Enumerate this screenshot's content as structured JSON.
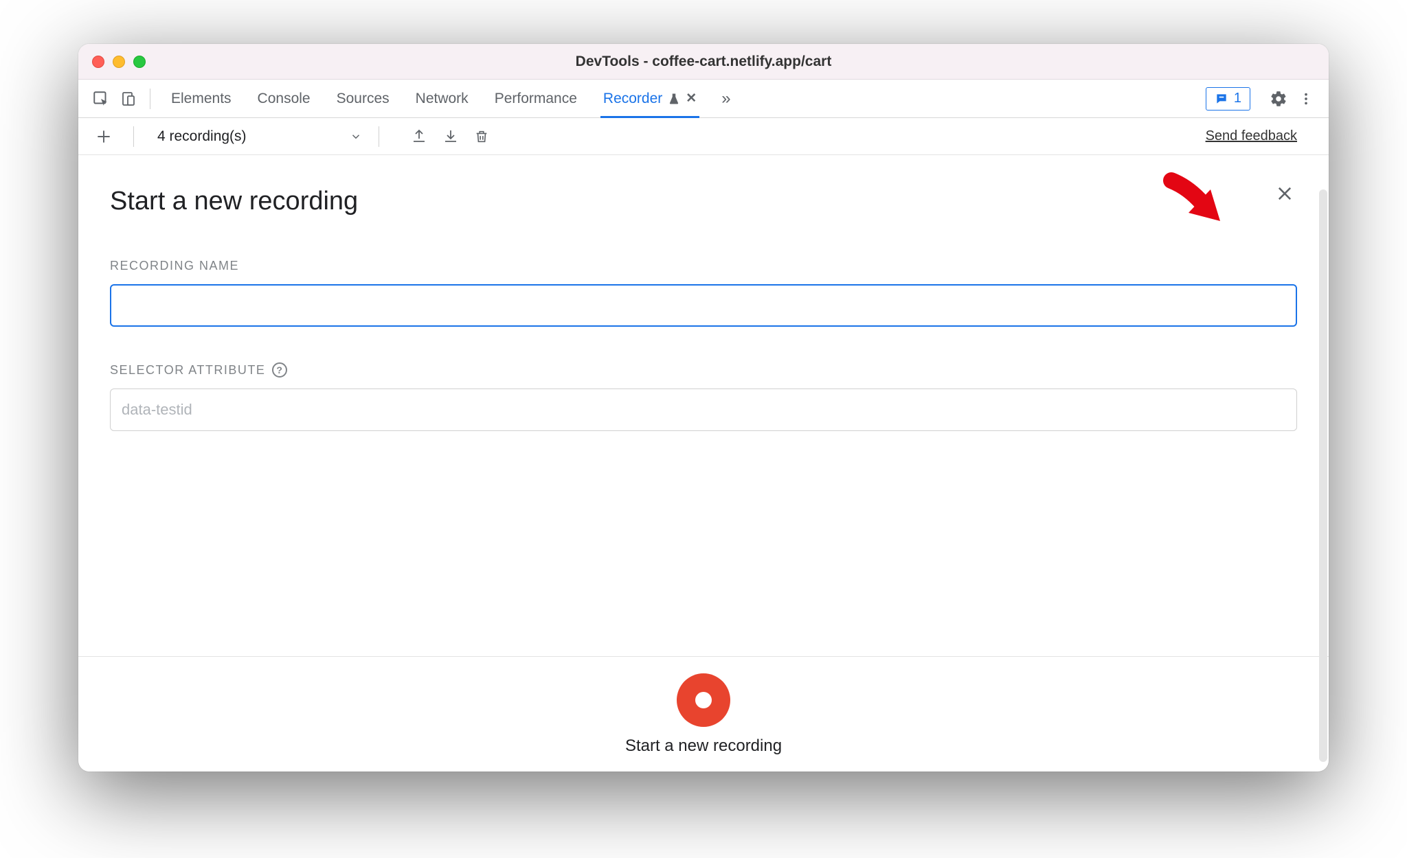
{
  "window": {
    "title": "DevTools - coffee-cart.netlify.app/cart"
  },
  "tabs": {
    "items": [
      "Elements",
      "Console",
      "Sources",
      "Network",
      "Performance"
    ],
    "active": {
      "label": "Recorder"
    }
  },
  "issues": {
    "count": "1"
  },
  "toolbar": {
    "recordings_label": "4 recording(s)",
    "feedback": "Send feedback"
  },
  "panel": {
    "title": "Start a new recording",
    "recording_name_label": "RECORDING NAME",
    "recording_name_value": "",
    "selector_label": "SELECTOR ATTRIBUTE",
    "selector_placeholder": "data-testid"
  },
  "footer": {
    "label": "Start a new recording"
  }
}
